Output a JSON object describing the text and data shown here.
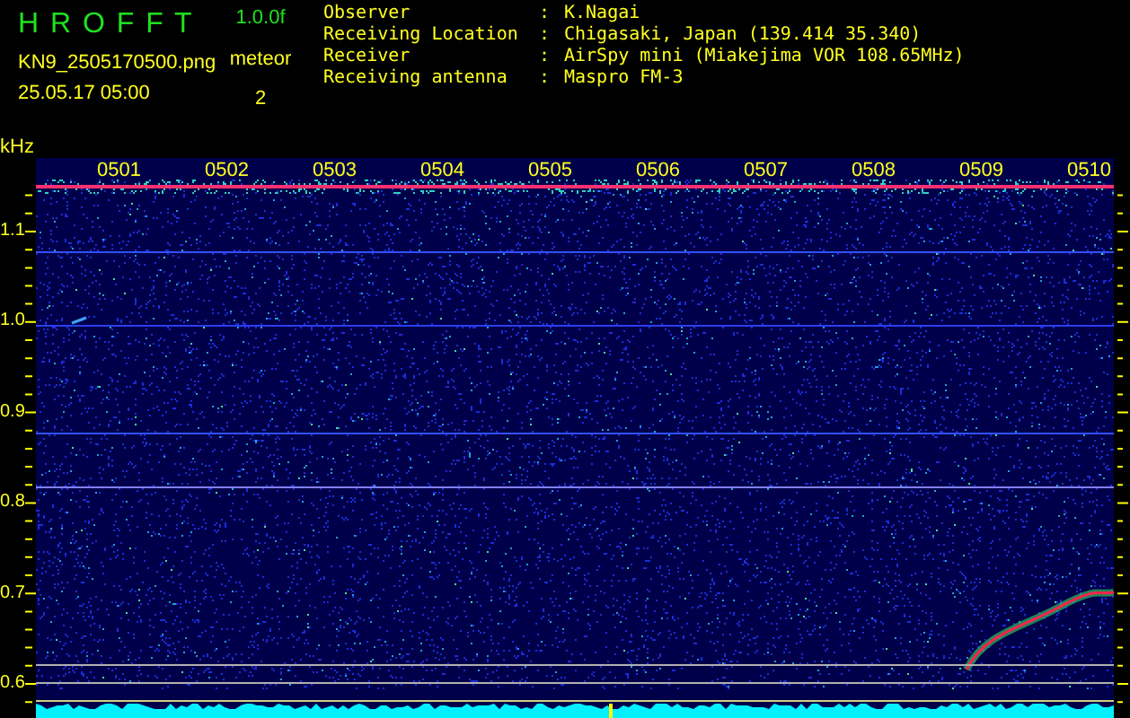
{
  "header": {
    "app_title": "H R O F F T",
    "version": "1.0.0f",
    "file_name": "KN9_2505170500.png",
    "date_time": "25.05.17 05:00",
    "detection_label": "meteor",
    "detection_count": "2"
  },
  "station_info": [
    {
      "label": "Observer",
      "separator": ":",
      "value": "K.Nagai"
    },
    {
      "label": "Receiving Location",
      "separator": ":",
      "value": "Chigasaki, Japan (139.414 35.340)"
    },
    {
      "label": "Receiver",
      "separator": ":",
      "value": "AirSpy mini (Miakejima VOR 108.65MHz)"
    },
    {
      "label": "Receiving antenna",
      "separator": ":",
      "value": "Maspro FM-3"
    }
  ],
  "spectrogram": {
    "y_unit": "kHz",
    "y_ticks": [
      "1.1",
      "1.0",
      "0.9",
      "0.8",
      "0.7",
      "0.6"
    ],
    "time_labels": [
      "0501",
      "0502",
      "0503",
      "0504",
      "0505",
      "0506",
      "0507",
      "0508",
      "0509",
      "0510"
    ]
  }
}
